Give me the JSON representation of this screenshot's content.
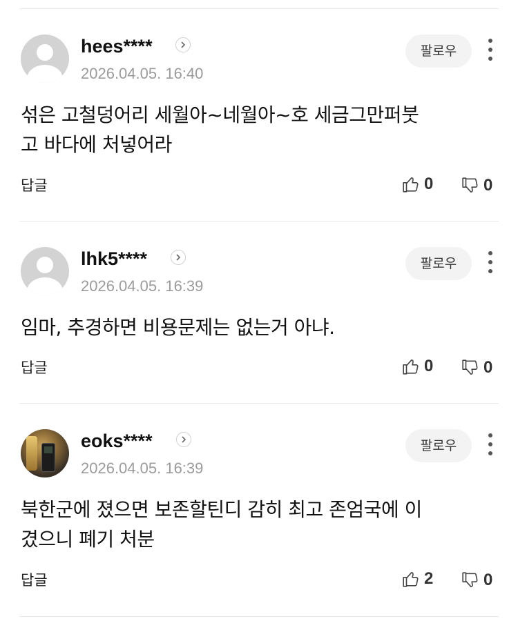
{
  "follow_label": "팔로우",
  "reply_label": "답글",
  "comments": [
    {
      "username": "hees****",
      "timestamp": "2026.04.05. 16:40",
      "text_lines": [
        "섞은 고철덩어리 세월아~네월아~호 세금그만퍼붓",
        "고 바다에 처넣어라"
      ],
      "likes": "0",
      "dislikes": "0",
      "avatar": "default-avatar"
    },
    {
      "username": "lhk5****",
      "timestamp": "2026.04.05. 16:39",
      "text_lines": [
        "임마, 추경하면 비용문제는 없는거 아냐."
      ],
      "likes": "0",
      "dislikes": "0",
      "avatar": "default-avatar"
    },
    {
      "username": "eoks****",
      "timestamp": "2026.04.05. 16:39",
      "text_lines": [
        "북한군에 졌으면 보존할틴디 감히 최고 존엄국에 이",
        "겼으니 폐기 처분"
      ],
      "likes": "2",
      "dislikes": "0",
      "avatar": "photo-avatar"
    }
  ],
  "icons": {
    "like": "thumbs-up-icon",
    "dislike": "thumbs-down-icon",
    "more": "more-vertical-icon",
    "profile_arrow": "chevron-right-icon"
  }
}
